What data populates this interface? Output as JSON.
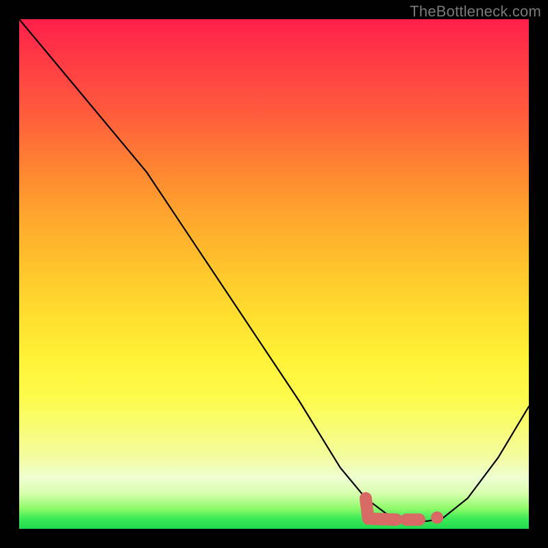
{
  "watermark": "TheBottleneck.com",
  "colors": {
    "frame": "#000000",
    "curve": "#000000",
    "accent": "#d86964",
    "gradient_top": "#ff1f4a",
    "gradient_mid": "#ffe52e",
    "gradient_bottom": "#22d94f"
  },
  "chart_data": {
    "type": "line",
    "title": "",
    "xlabel": "",
    "ylabel": "",
    "xlim": [
      0,
      100
    ],
    "ylim": [
      0,
      100
    ],
    "series": [
      {
        "name": "bottleneck-curve",
        "x": [
          0,
          10,
          20,
          25,
          35,
          45,
          55,
          63,
          68,
          72,
          76,
          80,
          83,
          88,
          94,
          100
        ],
        "y": [
          100,
          88,
          76,
          70,
          55,
          40,
          25,
          12,
          6,
          3,
          1.5,
          1.5,
          2,
          6,
          14,
          24
        ]
      }
    ],
    "highlight_segments": [
      {
        "name": "valley-L",
        "x": [
          68,
          68.5,
          74
        ],
        "y": [
          6,
          2,
          1.8
        ]
      },
      {
        "name": "valley-dash",
        "x": [
          76,
          78.5
        ],
        "y": [
          1.8,
          1.8
        ]
      }
    ],
    "highlight_points": [
      {
        "name": "valley-dot",
        "x": 82,
        "y": 2.2
      }
    ]
  }
}
